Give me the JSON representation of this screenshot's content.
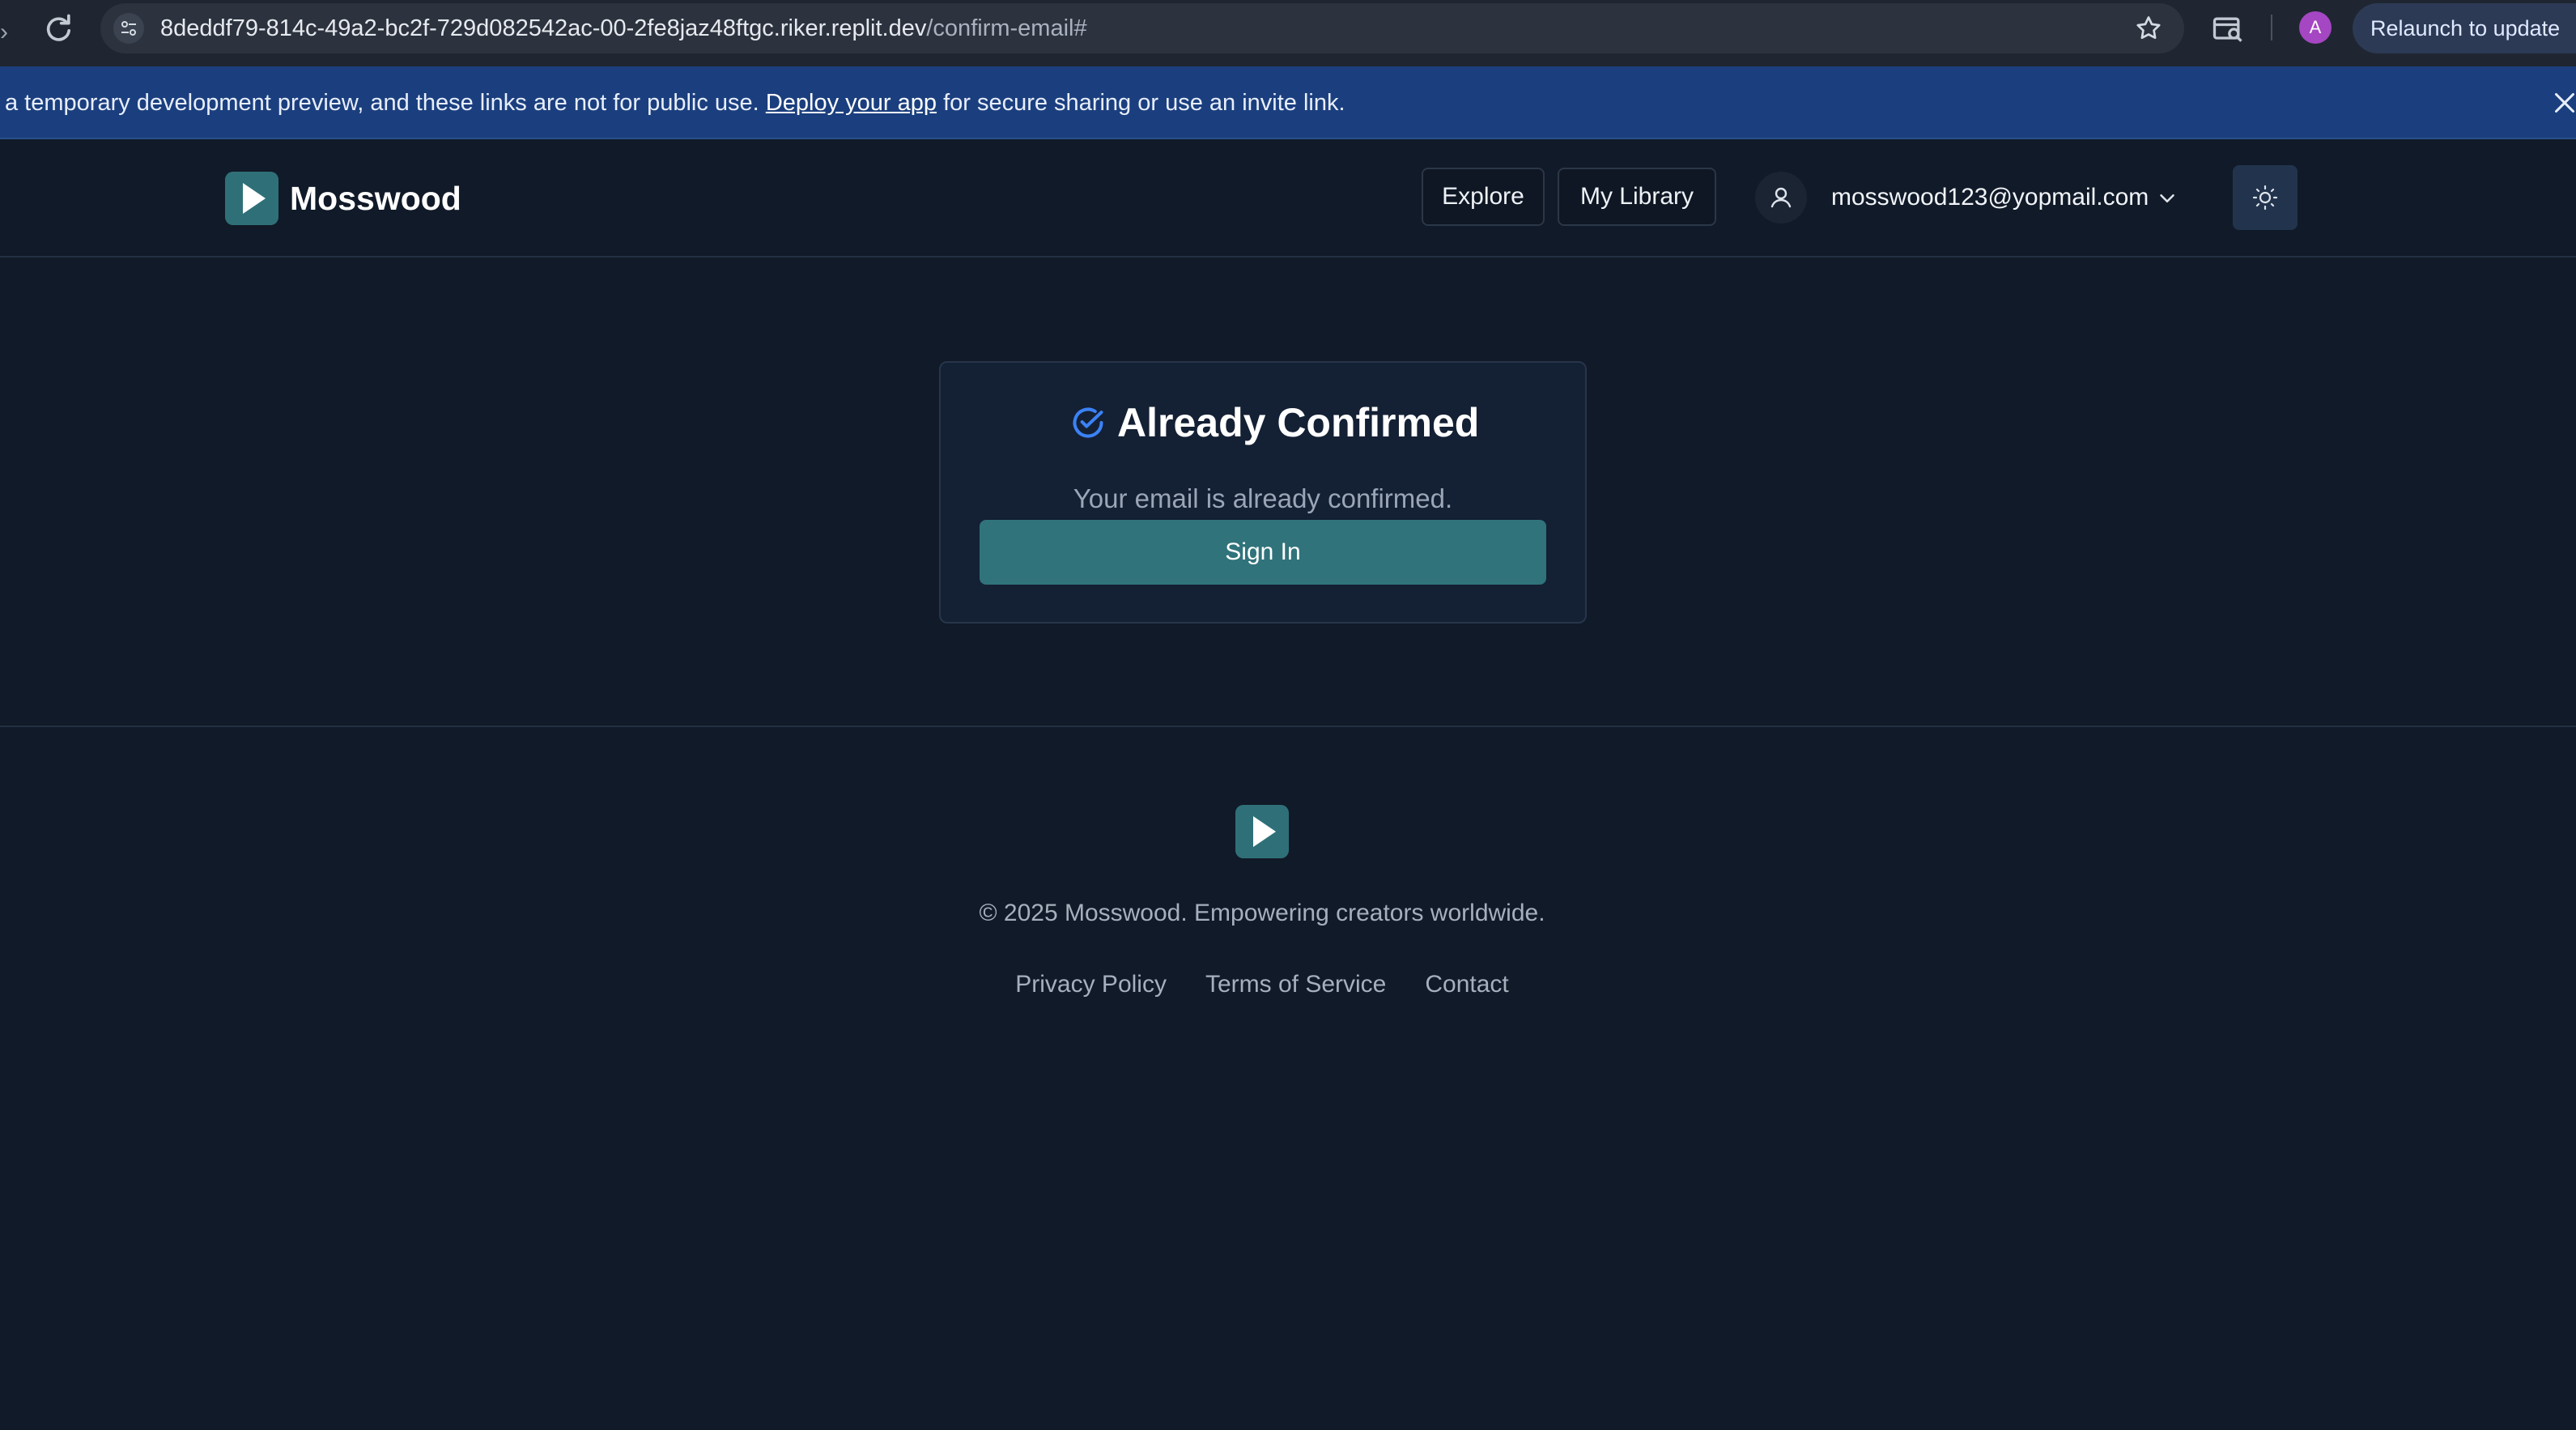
{
  "browser": {
    "url_host": "8deddf79-814c-49a2-bc2f-729d082542ac-00-2fe8jaz48ftgc.riker.replit.dev",
    "url_path": "/confirm-email#",
    "profile_initial": "A",
    "relaunch_label": "Relaunch to update"
  },
  "banner": {
    "text_before": "a temporary development preview, and these links are not for public use.",
    "link_text": "Deploy your app",
    "text_after": "for secure sharing or use an invite link."
  },
  "header": {
    "brand": "Mosswood",
    "nav": {
      "explore": "Explore",
      "library": "My Library"
    },
    "user_email": "mosswood123@yopmail.com"
  },
  "card": {
    "title": "Already Confirmed",
    "message": "Your email is already confirmed.",
    "button_label": "Sign In"
  },
  "footer": {
    "copyright": "© 2025 Mosswood. Empowering creators worldwide.",
    "links": [
      "Privacy Policy",
      "Terms of Service",
      "Contact"
    ]
  },
  "colors": {
    "background": "#111a28",
    "accent": "#30737b",
    "banner": "#1b3f7e",
    "check": "#3b82f6"
  }
}
